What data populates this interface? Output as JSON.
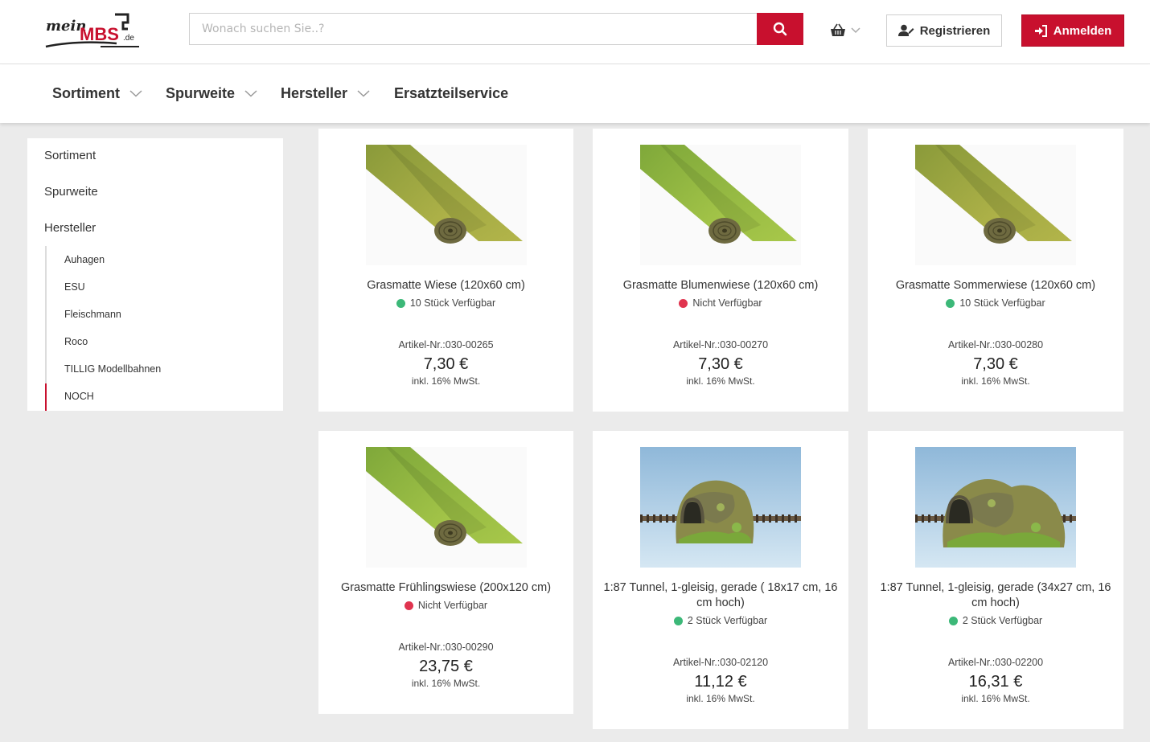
{
  "header": {
    "logo_text": "meinMBS.de",
    "search_placeholder": "Wonach suchen Sie..?",
    "register_label": "Registrieren",
    "login_label": "Anmelden",
    "accent_color": "#c8102e"
  },
  "nav": {
    "items": [
      {
        "label": "Sortiment",
        "has_dropdown": true
      },
      {
        "label": "Spurweite",
        "has_dropdown": true
      },
      {
        "label": "Hersteller",
        "has_dropdown": true
      },
      {
        "label": "Ersatzteilservice",
        "has_dropdown": false
      }
    ]
  },
  "sidebar": {
    "categories": [
      "Sortiment",
      "Spurweite",
      "Hersteller"
    ],
    "manufacturers": [
      "Auhagen",
      "ESU",
      "Fleischmann",
      "Roco",
      "TILLIG Modellbahnen",
      "NOCH"
    ],
    "active_manufacturer": "NOCH"
  },
  "products": [
    {
      "title": "Grasmatte Wiese (120x60 cm)",
      "stock": "10 Stück Verfügbar",
      "available": true,
      "article": "Artikel-Nr.:030-00265",
      "price": "7,30 €",
      "tax": "inkl. 16% MwSt.",
      "image": "grass-mat-icon"
    },
    {
      "title": "Grasmatte Blumenwiese (120x60 cm)",
      "stock": "Nicht Verfügbar",
      "available": false,
      "article": "Artikel-Nr.:030-00270",
      "price": "7,30 €",
      "tax": "inkl. 16% MwSt.",
      "image": "grass-mat-icon"
    },
    {
      "title": "Grasmatte Sommerwiese (120x60 cm)",
      "stock": "10 Stück Verfügbar",
      "available": true,
      "article": "Artikel-Nr.:030-00280",
      "price": "7,30 €",
      "tax": "inkl. 16% MwSt.",
      "image": "grass-mat-icon"
    },
    {
      "title": "Grasmatte Frühlingswiese (200x120 cm)",
      "stock": "Nicht Verfügbar",
      "available": false,
      "article": "Artikel-Nr.:030-00290",
      "price": "23,75 €",
      "tax": "inkl. 16% MwSt.",
      "image": "grass-mat-icon"
    },
    {
      "title": "1:87 Tunnel, 1-gleisig, gerade ( 18x17 cm, 16 cm hoch)",
      "stock": "2 Stück Verfügbar",
      "available": true,
      "article": "Artikel-Nr.:030-02120",
      "price": "11,12 €",
      "tax": "inkl. 16% MwSt.",
      "image": "tunnel-icon"
    },
    {
      "title": "1:87 Tunnel, 1-gleisig, gerade (34x27 cm, 16 cm hoch)",
      "stock": "2 Stück Verfügbar",
      "available": true,
      "article": "Artikel-Nr.:030-02200",
      "price": "16,31 €",
      "tax": "inkl. 16% MwSt.",
      "image": "tunnel-icon"
    }
  ],
  "status_colors": {
    "available": "#3cb878",
    "unavailable": "#e0344f"
  }
}
